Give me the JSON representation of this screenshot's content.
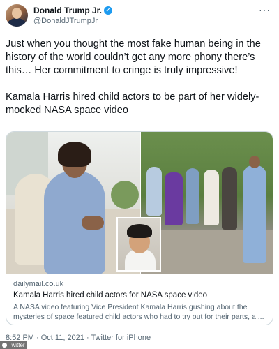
{
  "tweet": {
    "author_name": "Donald Trump Jr.",
    "handle": "@DonaldJTrumpJr",
    "more_label": "···",
    "verified_glyph": "✓",
    "text_paragraph_1": "Just when you thought the most fake human being in the history of the world couldn’t get any more phony there’s this… Her commitment to cringe is truly impressive!",
    "text_paragraph_2": "Kamala Harris hired child actors to be part of her widely-mocked NASA space video"
  },
  "link_card": {
    "domain": "dailymail.co.uk",
    "title": "Kamala Harris hired child actors for NASA space video",
    "description": "A NASA video featuring Vice President Kamala Harris gushing about the mysteries of space featured child actors who had to try out for their parts, a ..."
  },
  "footer": {
    "timestamp": "8:52 PM · Oct 11, 2021 · Twitter for iPhone"
  },
  "watermark": {
    "label": "Twitter"
  },
  "colors": {
    "verified_blue": "#1d9bf0",
    "text_primary": "#0f1419",
    "text_secondary": "#536471",
    "card_border": "#cfd9de"
  }
}
